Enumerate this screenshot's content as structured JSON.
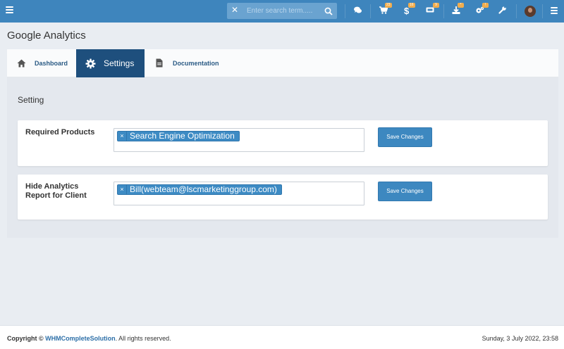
{
  "topbar": {
    "search_placeholder": "Enter search term.....",
    "badges": {
      "cart": "23",
      "billing": "16",
      "tickets": "9",
      "downloads": "*",
      "settings": "!"
    }
  },
  "page": {
    "title": "Google Analytics"
  },
  "tabs": [
    {
      "label": "Dashboard"
    },
    {
      "label": "Settings"
    },
    {
      "label": "Documentation"
    }
  ],
  "content": {
    "section_title": "Setting",
    "fields": [
      {
        "label": "Required Products",
        "tag": "Search Engine Optimization",
        "tag_remove": "×",
        "button": "Save Changes"
      },
      {
        "label": "Hide Analytics Report for Client",
        "tag": "Bill(webteam@lscmarketinggroup.com)",
        "tag_remove": "×",
        "button": "Save Changes"
      }
    ]
  },
  "footer": {
    "copyright_prefix": "Copyright ©",
    "brand": "WHMCompleteSolution",
    "copyright_suffix": ". All rights reserved.",
    "datetime": "Sunday, 3 July 2022, 23:58"
  },
  "colors": {
    "topbar": "#3e85bd",
    "active_tab": "#1e4f7d",
    "tag": "#3d8bc4",
    "button": "#3d88c0",
    "badge": "#f0ad4e"
  }
}
